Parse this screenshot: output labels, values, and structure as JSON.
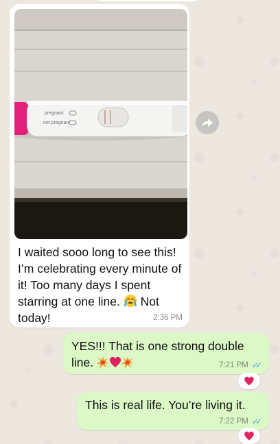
{
  "conversation": {
    "incoming": {
      "text": "I waited sooo long to see this! I’m celebrating every minute of it! Too many days I spent starring at one line.",
      "text_tail": "Not today!",
      "time": "2:36 PM",
      "photo": {
        "test_label_1": "pregnant",
        "test_label_2": "not pregnant"
      }
    },
    "outgoing": [
      {
        "text": "YES!!! That is one strong double line.",
        "time": "7:21 PM",
        "status": "read",
        "emojis": [
          "collision",
          "red-heart",
          "collision"
        ],
        "reaction": "red-heart"
      },
      {
        "text": "This is real life. You’re living it.",
        "time": "7:22 PM",
        "status": "read",
        "reaction": "red-heart"
      }
    ]
  },
  "colors": {
    "chat_bg": "#ece7df",
    "incoming_bubble": "#ffffff",
    "outgoing_bubble": "#dcf8c6",
    "read_ticks": "#4fa8e8",
    "heart": "#e0245e"
  },
  "icons": {
    "forward": "forward-arrow-icon",
    "crying": "loudly-crying-face-icon",
    "collision": "collision-icon",
    "heart": "red-heart-icon"
  }
}
